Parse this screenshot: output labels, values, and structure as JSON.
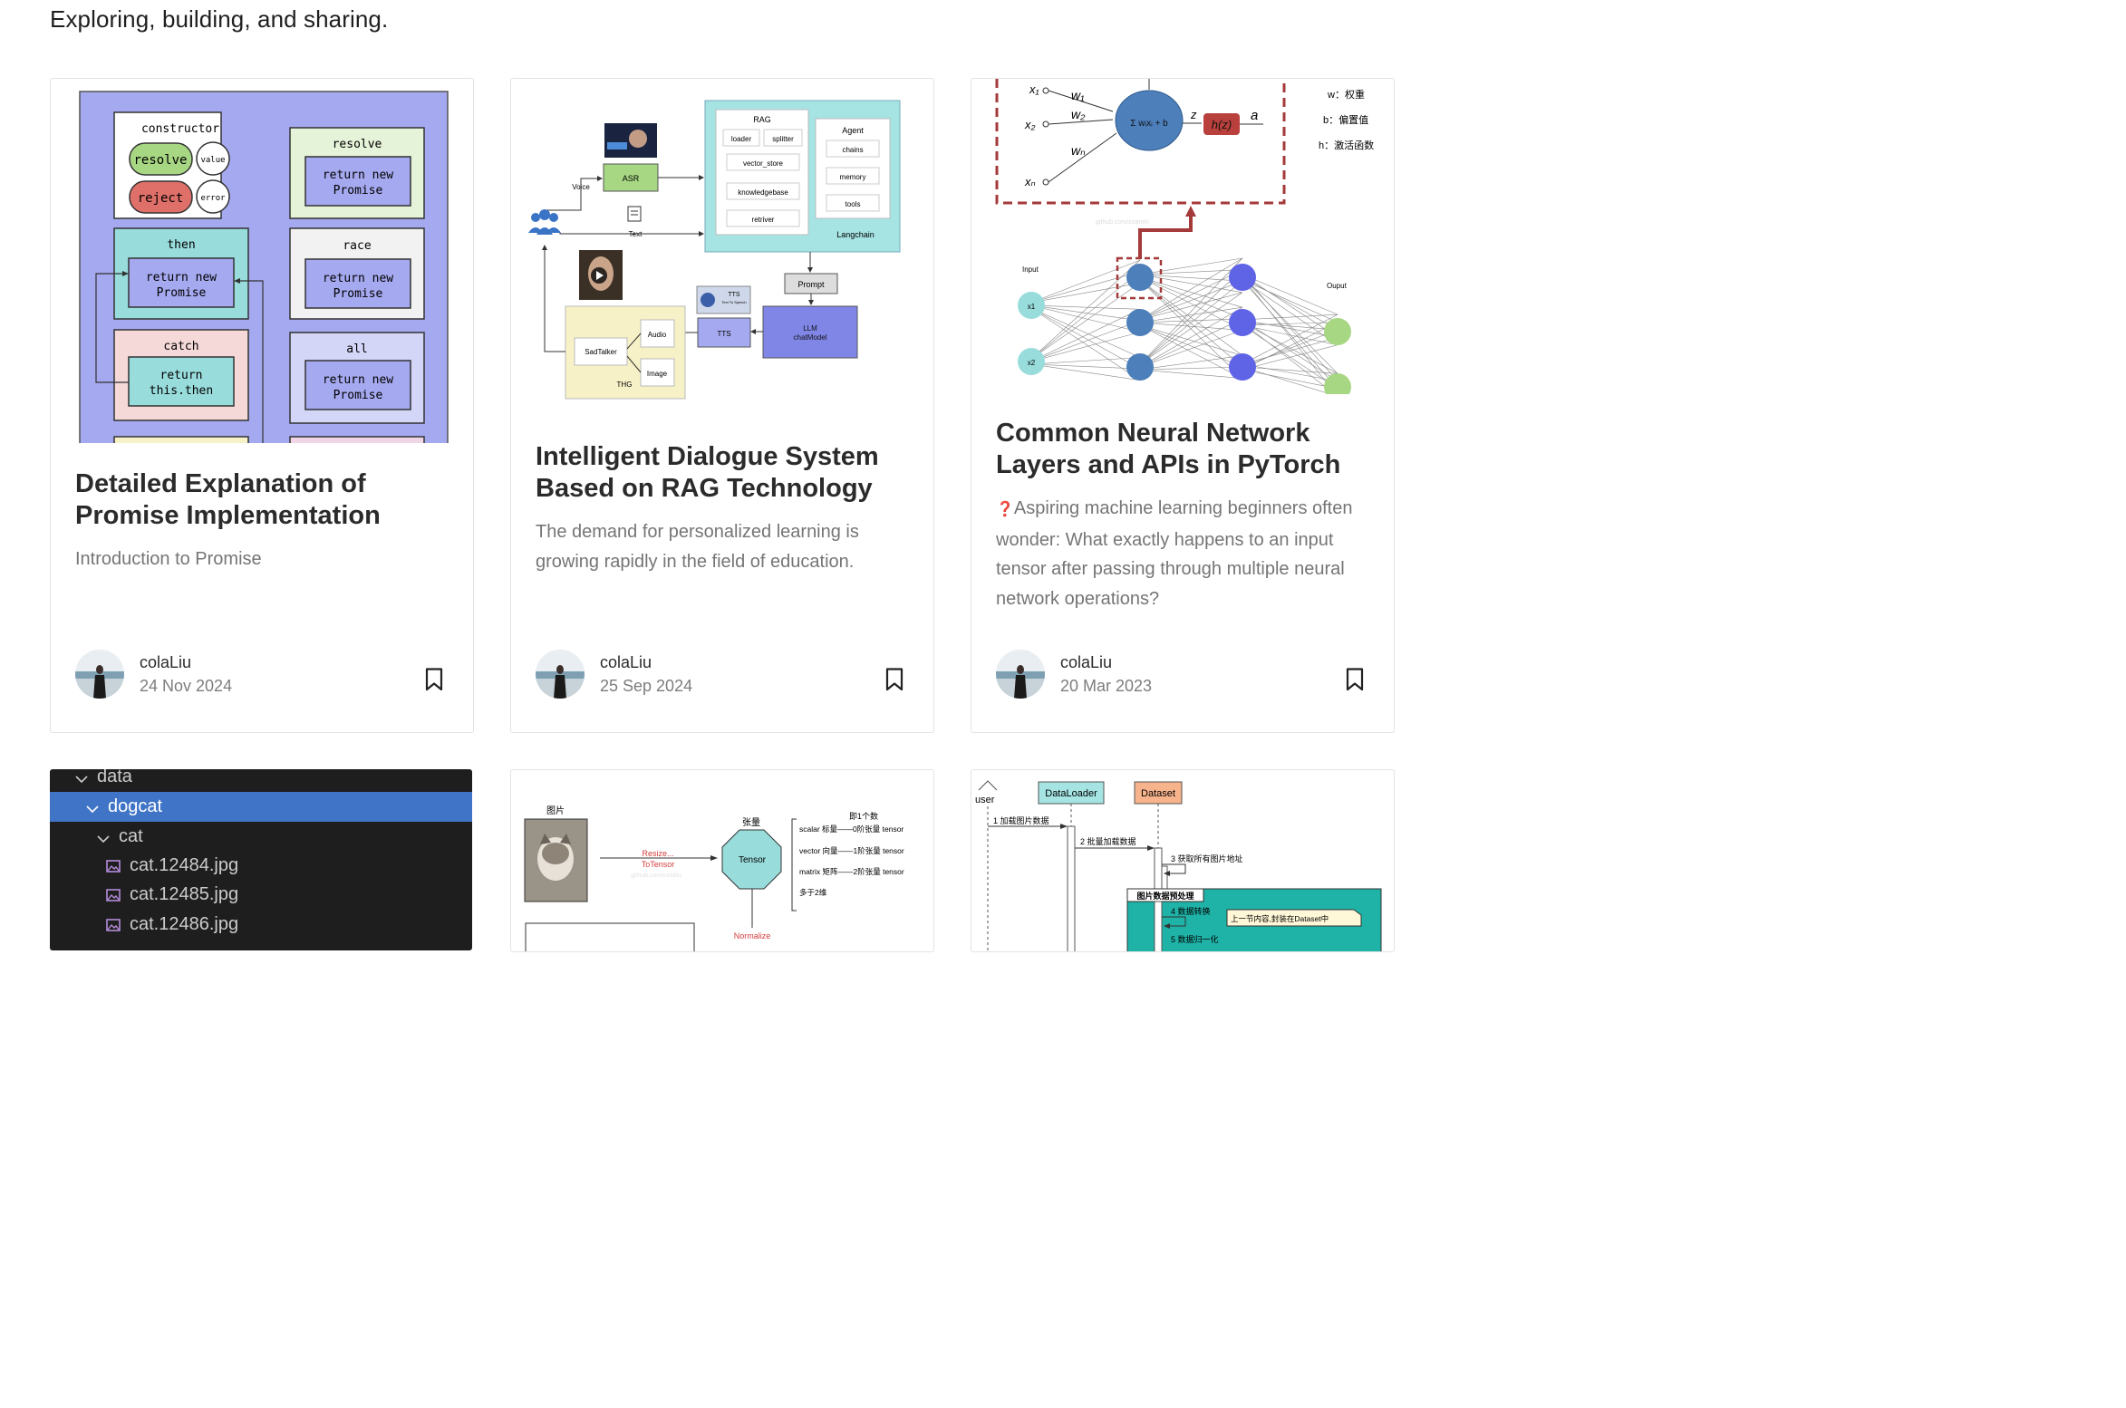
{
  "page": {
    "tagline": "Exploring, building, and sharing."
  },
  "cards": [
    {
      "title": "Detailed Explanation of Promise Implementation",
      "description": "Introduction to Promise",
      "author": "colaLiu",
      "date": "24 Nov 2024",
      "cover": {
        "constructor": "constructor",
        "resolve_pill": "resolve",
        "reject_pill": "reject",
        "value": "value",
        "error": "error",
        "resolve": "resolve",
        "then": "then",
        "race": "race",
        "catch": "catch",
        "all": "all",
        "return_new": "return new",
        "promise": "Promise",
        "return": "return",
        "this_then": "this.then"
      }
    },
    {
      "title": "Intelligent Dialogue System Based on RAG Technology",
      "description": "The demand for personalized learning is growing rapidly in the field of education.",
      "author": "colaLiu",
      "date": "25 Sep 2024",
      "cover": {
        "rag": "RAG",
        "loader": "loader",
        "splitter": "splitter",
        "vector_store": "vector_store",
        "knowledgebase": "knowledgebase",
        "retriver": "retriver",
        "agent": "Agent",
        "chains": "chains",
        "memory": "memory",
        "tools": "tools",
        "langchain": "Langchain",
        "asr": "ASR",
        "voice": "Voice",
        "text": "Text",
        "prompt": "Prompt",
        "llm": "LLM",
        "chatmodel": "chatModel",
        "tts": "TTS",
        "tts_small": "TTS",
        "tts_sub": "Text To Speech",
        "audio": "Audio",
        "image": "Image",
        "sadtalker": "SadTalker",
        "thg": "THG"
      }
    },
    {
      "title": "Common Neural Network Layers and APIs in PyTorch",
      "description": "Aspiring machine learning beginners often wonder: What exactly happens to an input tensor after passing through multiple neural network operations?",
      "desc_prefix": "❓",
      "author": "colaLiu",
      "date": "20 Mar 2023",
      "cover": {
        "x1": "x₁",
        "x2": "x₂",
        "xn": "xₙ",
        "w1": "w₁",
        "w2": "w₂",
        "wn": "wₙ",
        "sum": "Σ wᵢxᵢ + b",
        "z": "z",
        "hz": "h(z)",
        "a": "a",
        "legend_w": "w：权重",
        "legend_b": "b：偏置值",
        "legend_h": "h：激活函数",
        "input": "Input",
        "output": "Ouput",
        "node_x1": "x1",
        "node_x2": "x2",
        "watermark": "github.com/zoamin"
      }
    }
  ],
  "bottom": {
    "tree": {
      "rows": [
        {
          "label": "data",
          "type": "folder",
          "selected": false
        },
        {
          "label": "dogcat",
          "type": "folder",
          "selected": true
        },
        {
          "label": "cat",
          "type": "folder",
          "selected": false
        },
        {
          "label": "cat.12484.jpg",
          "type": "file",
          "selected": false
        },
        {
          "label": "cat.12485.jpg",
          "type": "file",
          "selected": false
        },
        {
          "label": "cat.12486.jpg",
          "type": "file",
          "selected": false
        }
      ]
    },
    "tensor": {
      "picture": "图片",
      "resize": "Resize...",
      "totensor": "ToTensor",
      "tensor_label": "张量",
      "tensor": "Tensor",
      "count": "即1个数",
      "scalar": "scalar 标量——0阶张量 tensor",
      "vector": "vector 向量——1阶张量 tensor",
      "matrix": "matrix 矩阵——2阶张量 tensor",
      "more": "多于2维",
      "normalize": "Normalize",
      "watermark": "github.com/colaliu"
    },
    "sequence": {
      "user": "user",
      "dataloader": "DataLoader",
      "dataset": "Dataset",
      "step1": "1 加载图片数据",
      "step2": "2 批量加载数据",
      "step3": "3 获取所有图片地址",
      "group": "图片数据预处理",
      "step4": "4 数据转换",
      "note": "上一节内容,封装在Dataset中",
      "step5": "5 数据归一化"
    }
  },
  "colors": {
    "promise_bg": "#a5a9ef",
    "accent_blue": "#3f74c6",
    "rag_teal": "#a6e4e4"
  }
}
